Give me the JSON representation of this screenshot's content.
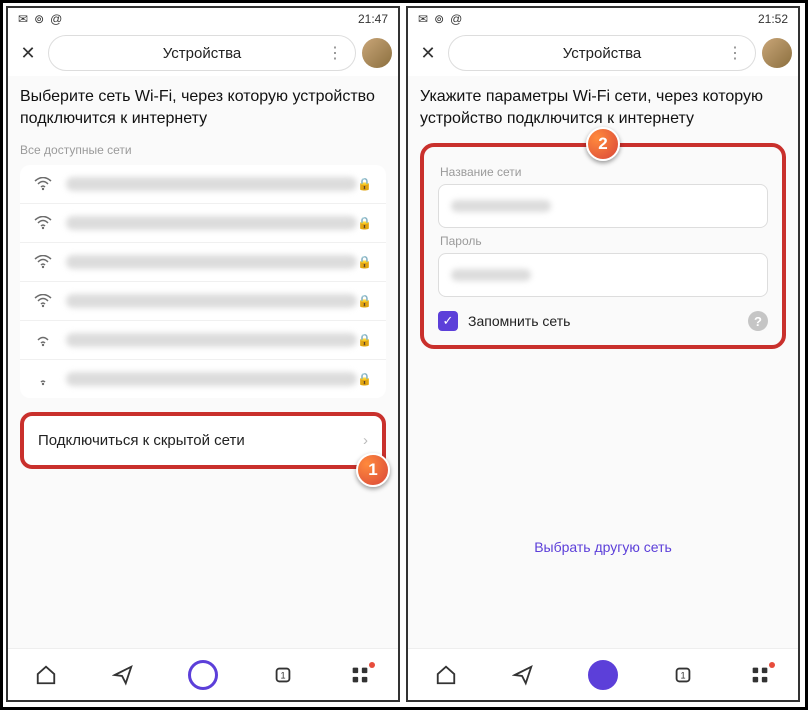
{
  "left": {
    "status_time": "21:47",
    "header_title": "Устройства",
    "heading": "Выберите сеть Wi-Fi, через которую устройство подключится к интернету",
    "section_label": "Все доступные сети",
    "hidden_network_label": "Подключиться к скрытой сети",
    "callout": "1"
  },
  "right": {
    "status_time": "21:52",
    "header_title": "Устройства",
    "heading": "Укажите параметры Wi-Fi сети, через которую устройство подключится к интернету",
    "field_ssid_label": "Название сети",
    "field_pass_label": "Пароль",
    "remember_label": "Запомнить сеть",
    "choose_other_label": "Выбрать другую сеть",
    "callout": "2"
  }
}
